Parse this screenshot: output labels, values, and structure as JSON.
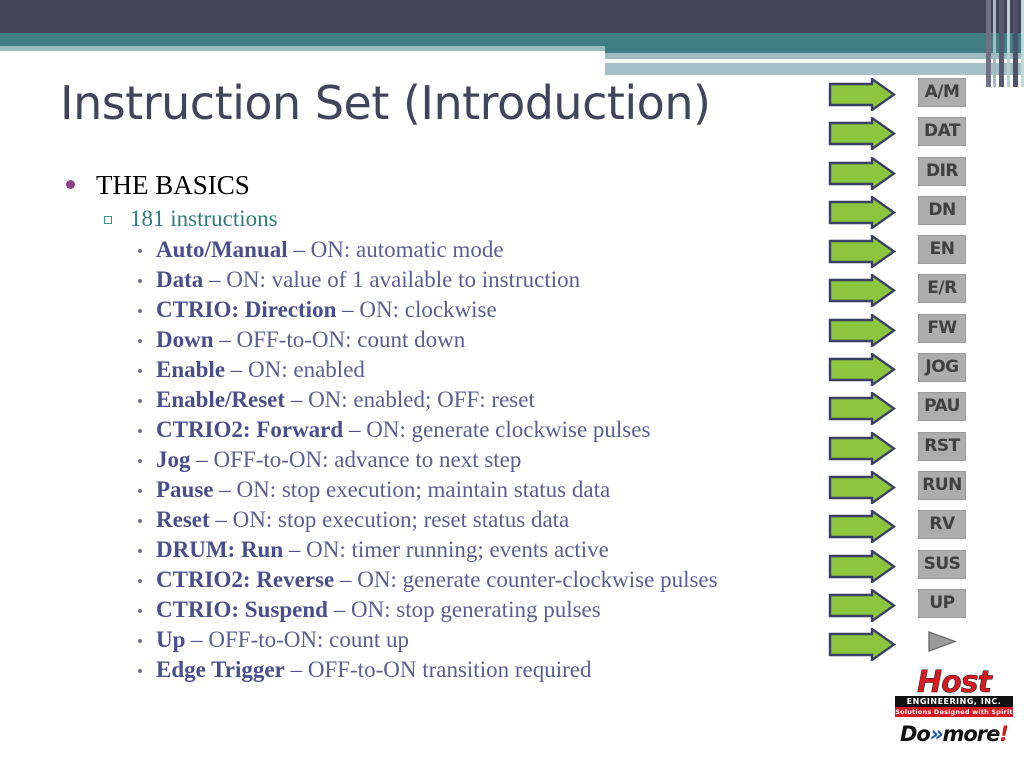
{
  "slide": {
    "title": "Instruction Set (Introduction)"
  },
  "colors": {
    "header_dark": "#434459",
    "header_teal": "#3f7f84",
    "header_pale": "#9dbcc2",
    "title_text": "#41445a",
    "level1_bullet": "#923f8c",
    "level2_text": "#2e7d79",
    "level3_text": "#51548c",
    "arrow_green": "#8cc63f",
    "arrow_outline": "#3b3f63",
    "badge_gray": "#adadad",
    "logo_red": "#d71921",
    "logo_blue": "#1b57a5"
  },
  "content": {
    "level1": {
      "marker": "bullet-dot-icon",
      "text": "THE BASICS"
    },
    "level2": {
      "marker": "hollow-square-icon",
      "text": "181 instructions"
    },
    "items": [
      {
        "marker": "small-dot-icon",
        "term": "Auto/Manual",
        "dash": " – ",
        "desc": "ON: automatic mode"
      },
      {
        "marker": "small-dot-icon",
        "term": "Data",
        "dash": " – ",
        "desc": "ON: value of 1 available to instruction"
      },
      {
        "marker": "small-dot-icon",
        "term": "CTRIO: Direction",
        "dash": " – ",
        "desc": "ON: clockwise"
      },
      {
        "marker": "small-dot-icon",
        "term": "Down",
        "dash": " – ",
        "desc": "OFF-to-ON: count down"
      },
      {
        "marker": "small-dot-icon",
        "term": "Enable",
        "dash": " – ",
        "desc": "ON: enabled"
      },
      {
        "marker": "small-dot-icon",
        "term": "Enable/Reset",
        "dash": " – ",
        "desc": "ON: enabled; OFF: reset"
      },
      {
        "marker": "small-dot-icon",
        "term": "CTRIO2: Forward",
        "dash": " – ",
        "desc": "ON: generate clockwise pulses"
      },
      {
        "marker": "small-dot-icon",
        "term": "Jog",
        "dash": " – ",
        "desc": "OFF-to-ON: advance to next step"
      },
      {
        "marker": "small-dot-icon",
        "term": "Pause",
        "dash": " – ",
        "desc": "ON: stop execution; maintain status data"
      },
      {
        "marker": "small-dot-icon",
        "term": "Reset",
        "dash": " – ",
        "desc": "ON: stop execution; reset status data"
      },
      {
        "marker": "small-dot-icon",
        "term": "DRUM: Run",
        "dash": " – ",
        "desc": "ON: timer running; events active"
      },
      {
        "marker": "small-dot-icon",
        "term": "CTRIO2: Reverse",
        "dash": " – ",
        "desc": "ON: generate counter-clockwise pulses"
      },
      {
        "marker": "small-dot-icon",
        "term": "CTRIO: Suspend",
        "dash": " – ",
        "desc": "ON: stop generating pulses"
      },
      {
        "marker": "small-dot-icon",
        "term": "Up",
        "dash": " – ",
        "desc": "OFF-to-ON: count up"
      },
      {
        "marker": "small-dot-icon",
        "term": "Edge Trigger",
        "dash": " – ",
        "desc": "OFF-to-ON transition required"
      }
    ]
  },
  "badges": [
    {
      "label": "A/M",
      "type": "text"
    },
    {
      "label": "DAT",
      "type": "text"
    },
    {
      "label": "DIR",
      "type": "text"
    },
    {
      "label": "DN",
      "type": "text"
    },
    {
      "label": "EN",
      "type": "text"
    },
    {
      "label": "E/R",
      "type": "text"
    },
    {
      "label": "FW",
      "type": "text"
    },
    {
      "label": "JOG",
      "type": "text"
    },
    {
      "label": "PAU",
      "type": "text"
    },
    {
      "label": "RST",
      "type": "text"
    },
    {
      "label": "RUN",
      "type": "text"
    },
    {
      "label": "RV",
      "type": "text"
    },
    {
      "label": "SUS",
      "type": "text"
    },
    {
      "label": "UP",
      "type": "text"
    },
    {
      "label": "",
      "type": "triangle"
    }
  ],
  "logo": {
    "brand": "Host",
    "company": "ENGINEERING, INC.",
    "tagline": "Solutions Designed with Spirit",
    "product_do": "Do",
    "product_chev": "»",
    "product_more": "more",
    "product_bang": "!"
  }
}
